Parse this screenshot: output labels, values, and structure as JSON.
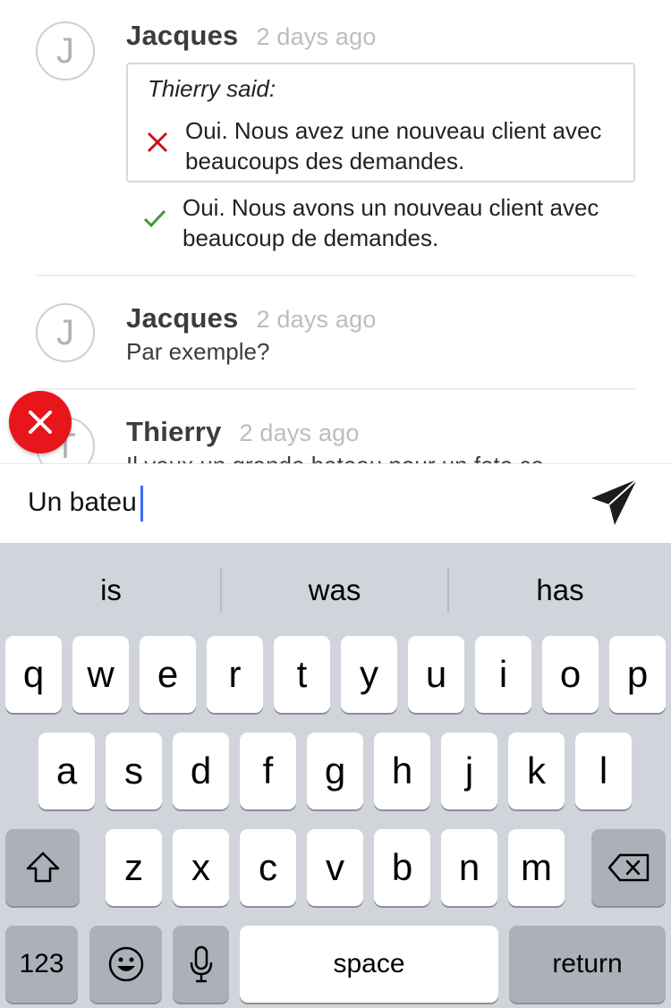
{
  "messages": [
    {
      "avatar_initial": "J",
      "author": "Jacques",
      "time": "2 days ago",
      "quote_label": "Thierry said:",
      "incorrect_line1": "Oui. Nous avez une nouveau client avec",
      "incorrect_line2": "beaucoups des demandes.",
      "correct_line1": "Oui. Nous avons un nouveau client avec",
      "correct_line2": "beaucoup de demandes."
    },
    {
      "avatar_initial": "J",
      "author": "Jacques",
      "time": "2 days ago",
      "text": "Par exemple?"
    },
    {
      "avatar_initial": "T",
      "author": "Thierry",
      "time": "2 days ago",
      "text": "Il veux un grande bateau pour un fete ce"
    }
  ],
  "composer": {
    "value": "Un bateu"
  },
  "colors": {
    "error": "#e8151b",
    "correct": "#3e9a3a",
    "caret": "#3b6cf0"
  },
  "keyboard": {
    "suggestions": [
      "is",
      "was",
      "has"
    ],
    "row1": [
      "q",
      "w",
      "e",
      "r",
      "t",
      "y",
      "u",
      "i",
      "o",
      "p"
    ],
    "row2": [
      "a",
      "s",
      "d",
      "f",
      "g",
      "h",
      "j",
      "k",
      "l"
    ],
    "row3": [
      "z",
      "x",
      "c",
      "v",
      "b",
      "n",
      "m"
    ],
    "numbers_label": "123",
    "space_label": "space",
    "return_label": "return"
  }
}
